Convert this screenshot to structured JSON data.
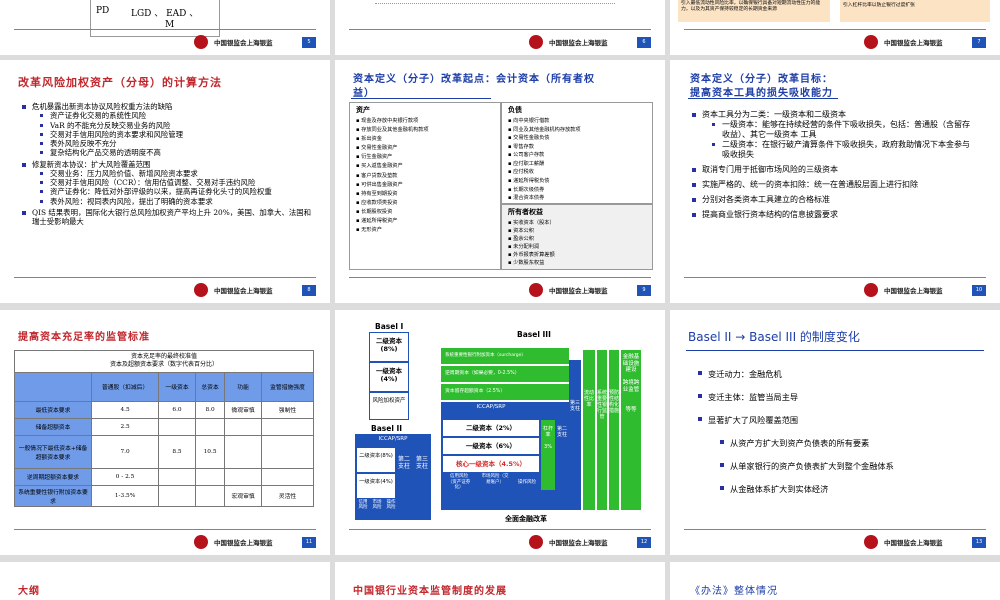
{
  "bank_name": "中国银监会上海银监",
  "slides": {
    "s5": {
      "page": "5",
      "pd": "PD",
      "lgd": "LGD 、 EAD 、",
      "m": "M"
    },
    "s6": {
      "page": "6"
    },
    "s7": {
      "page": "7",
      "box1": "引入最低流动性风险比率，以确保银行具备对短期流动性压力的能力，以及为其资产保持较稳定的长期资金来源",
      "box2": "引入杠杆比率以防止银行过度扩张"
    },
    "s8": {
      "page": "8",
      "title": "改革风险加权资产（分母）的计算方法",
      "items": [
        {
          "text": "危机暴露出新资本协议风险权重方法的缺陷",
          "sub": [
            "资产证券化交易的系统性风险",
            "VaR 的不能充分反映交易业务的风险",
            "交易对手信用风险的资本要求和风险管理",
            "表外风险反映不充分",
            "复杂结构化产品交易的透明度不高"
          ]
        },
        {
          "text": "修复新资本协议：扩大风险覆盖范围",
          "sub": [
            "交易业务：压力风险价值、新增风险资本要求",
            "交易对手信用风险（CCR）：信用估值调整、交易对手违约风险",
            "资产证券化：降低对外部评级的以来，提高再证券化头寸的风险权重",
            "表外风险：视同表内风险，提出了明确的资本要求"
          ]
        },
        {
          "text": "QIS 结果表明，国际化大银行总风险加权资产平均上升 20%，美国、加拿大、法国和瑞士受影响最大",
          "sub": []
        }
      ]
    },
    "s9": {
      "page": "9",
      "title_line1": "资本定义（分子）改革起点：会计资本（所有者权",
      "title_line2": "益）",
      "assets_head": "资产",
      "assets": [
        "现金及存放中央银行款项",
        "存放同业及其他金融机构款项",
        "拆出资金",
        "交易性金融资产",
        "衍生金融资产",
        "买入返售金融资产",
        "客户贷款及垫款",
        "可供出售金融资产",
        "持有至到期投资",
        "应收款项类投资",
        "长期股权投资",
        "递延所得税资产",
        "无形资产"
      ],
      "liab_head": "负债",
      "liabs": [
        "向中央银行借款",
        "同业及其他金融机构存放款项",
        "交易性金融负债",
        "零售存款",
        "公司客户存款",
        "应付职工薪酬",
        "应付税收",
        "递延所得税负债",
        "长期次级债券",
        "混合资本债券"
      ],
      "equity_head": "所有者权益",
      "equity": [
        "实收资本（股本）",
        "资本公积",
        "盈余公积",
        "未分配利润",
        "外币报表折算差额",
        "少数股东权益"
      ]
    },
    "s10": {
      "page": "10",
      "title_line1": "资本定义（分子）改革目标：",
      "title_line2": "提高资本工具的损失吸收能力",
      "items": [
        {
          "text": "资本工具分为二类：一级资本和二级资本",
          "sub": [
            "一级资本：能够在持续经营的条件下吸收损失，包括：普通股（含留存收益）、其它一级资本 工具",
            "二级资本：在银行破产清算条件下吸收损失，政府救助情况下本金参与吸收损失"
          ]
        },
        {
          "text": "取消专门用于抵御市场风险的三级资本",
          "sub": []
        },
        {
          "text": "实施严格的、统一的资本扣除：统一在普通股层面上进行扣除",
          "sub": []
        },
        {
          "text": "分别对各类资本工具建立的合格标准",
          "sub": []
        },
        {
          "text": "提高商业银行资本结构的信息披露要求",
          "sub": []
        }
      ]
    },
    "s11": {
      "page": "11",
      "title": "提高资本充足率的监管标准",
      "cap1": "资本充足率的最终校准值",
      "cap2": "资本及超额资本要求（数字代表百分比）",
      "headers": [
        "",
        "普通股（扣减后）",
        "一级资本",
        "总资本",
        "功能",
        "监管措施强度"
      ],
      "rows": [
        [
          "最低资本要求",
          "4.5",
          "6.0",
          "8.0",
          "微观审慎",
          "强制性"
        ],
        [
          "储备超额资本",
          "2.5",
          "",
          "",
          "",
          ""
        ],
        [
          "一般情况下最低资本+储备超额资本要求",
          "7.0",
          "8.5",
          "10.5",
          "",
          ""
        ],
        [
          "逆周期超额资本要求",
          "0 - 2.5",
          "",
          "",
          "",
          ""
        ],
        [
          "系统重要性银行附加资本要求",
          "1-3.5%",
          "",
          "",
          "宏观审慎",
          "灵活性"
        ]
      ]
    },
    "s12": {
      "page": "12",
      "basel1": "Basel I",
      "basel3": "Basel III",
      "basel2": "Basel II",
      "b1_tier2": "二级资本(8%)",
      "b1_tier1": "一级资本(4%)",
      "b1_risk": "风险加权资产",
      "surcharge": "系统重要性银行附加资本（surcharge）",
      "countercyc": "逆周期资本（如果必要，0-2.5%）",
      "conserv": "资本留存超额资本（2.5%）",
      "icaap": "ICCAP/SRP",
      "b3_tier2": "二级资本（2%）",
      "b3_tier1": "一级资本（6%）",
      "b3_core": "核心一级资本（4.5%）",
      "b2_icaap": "ICCAP/SRP",
      "b2_tier2": "二级资本(8%)",
      "b2_tier1": "一级资本(4%)",
      "pillar2": "第二支柱",
      "pillar3": "第三支柱",
      "credit": "信用风险",
      "market": "市场风险",
      "oper": "操作风险",
      "b3_credit": "信用风险（资产证券化）",
      "b3_market": "市场风险（交易账户）",
      "b3_oper": "操作风险",
      "leverage": "杠杆率",
      "lev_val": "3%",
      "liquidity": "流动性比率",
      "green_a": "系统重要性银行监管",
      "green_b": "预防性结构化措施",
      "green_top": "金融基础设施建设",
      "green_right": "跨境跨业监管",
      "etc": "等等",
      "bottom": "全面金融改革"
    },
    "s13": {
      "page": "13",
      "title": "Basel II → Basel III 的制度变化",
      "items": [
        {
          "text": "变迁动力：金融危机",
          "lvl": 1
        },
        {
          "text": "变迁主体：监管当局主导",
          "lvl": 1
        },
        {
          "text": "显著扩大了风险覆盖范围",
          "lvl": 1
        },
        {
          "text": "从资产方扩大到资产负债表的所有要素",
          "lvl": 2
        },
        {
          "text": "从单家银行的资产负债表扩大到整个金融体系",
          "lvl": 2
        },
        {
          "text": "从金融体系扩大到实体经济",
          "lvl": 2
        }
      ]
    },
    "s14": {
      "title": "大纲"
    },
    "s15": {
      "title": "中国银行业资本监管制度的发展"
    },
    "s16": {
      "title": "《办法》整体情况"
    }
  },
  "colors": {
    "red_title": "#c1272d",
    "blue_title": "#1d3ea6",
    "green": "#2fbd2f",
    "blue_box": "#1f53b8"
  }
}
